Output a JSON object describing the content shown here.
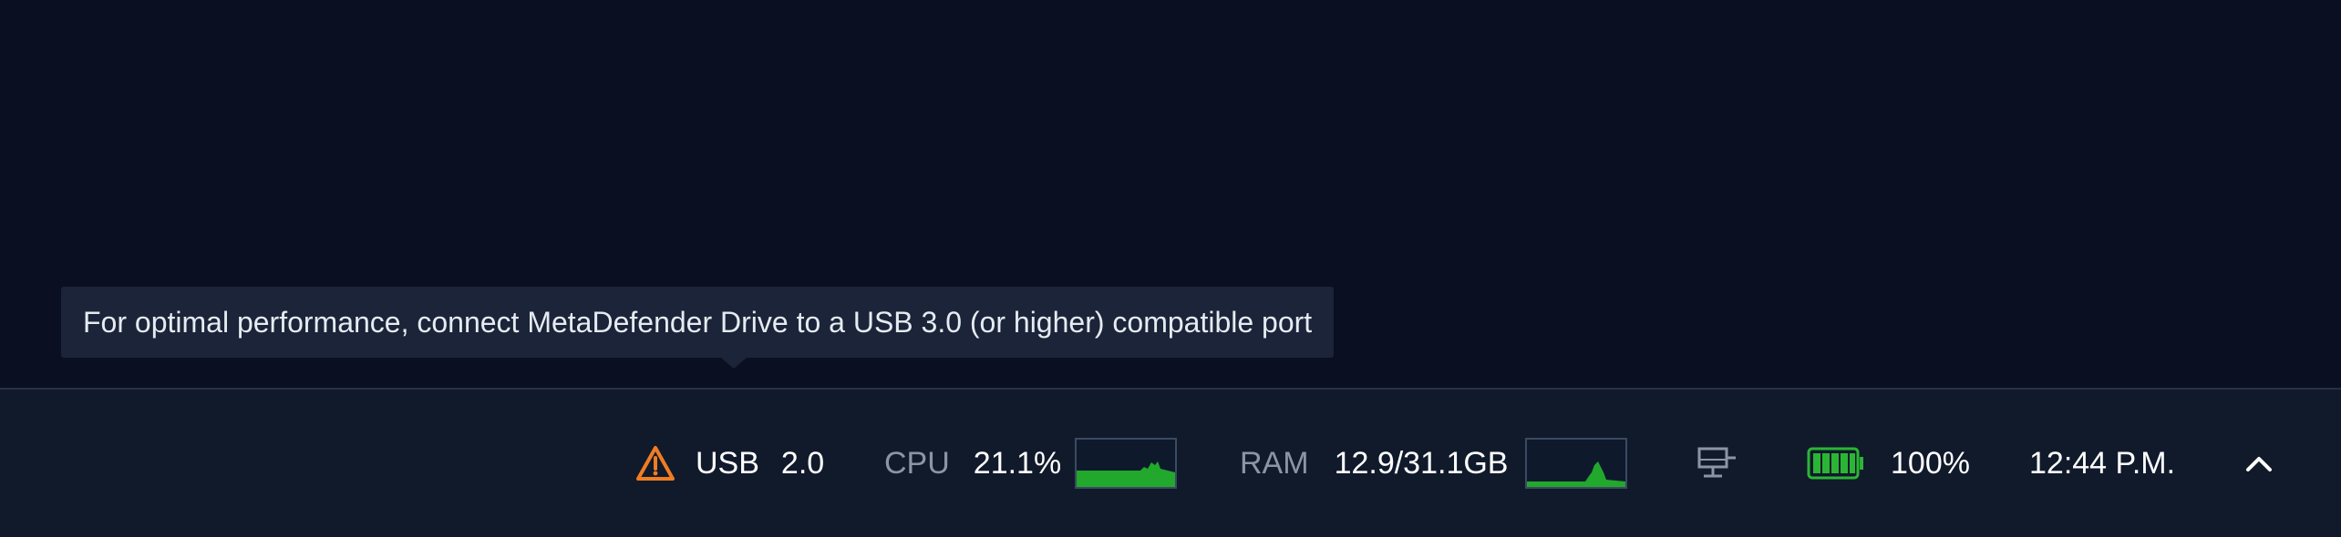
{
  "tooltip": {
    "text": "For optimal performance, connect MetaDefender Drive to a USB 3.0 (or higher) compatible port"
  },
  "taskbar": {
    "usb": {
      "icon": "warning-triangle-icon",
      "label": "USB",
      "value": "2.0"
    },
    "cpu": {
      "label": "CPU",
      "value": "21.1%"
    },
    "ram": {
      "label": "RAM",
      "value": "12.9/31.1GB"
    },
    "network": {
      "icon": "network-computer-icon"
    },
    "battery": {
      "icon": "battery-icon",
      "percent": 100,
      "label": "100%"
    },
    "clock": {
      "time": "12:44 P.M."
    },
    "expand": {
      "icon": "chevron-up-icon"
    }
  },
  "colors": {
    "background": "#0a0f21",
    "taskbar": "#111a2b",
    "tooltip": "#1b2438",
    "warning": "#f07d22",
    "graph_green": "#22a82c",
    "battery_green": "#2bb534"
  }
}
